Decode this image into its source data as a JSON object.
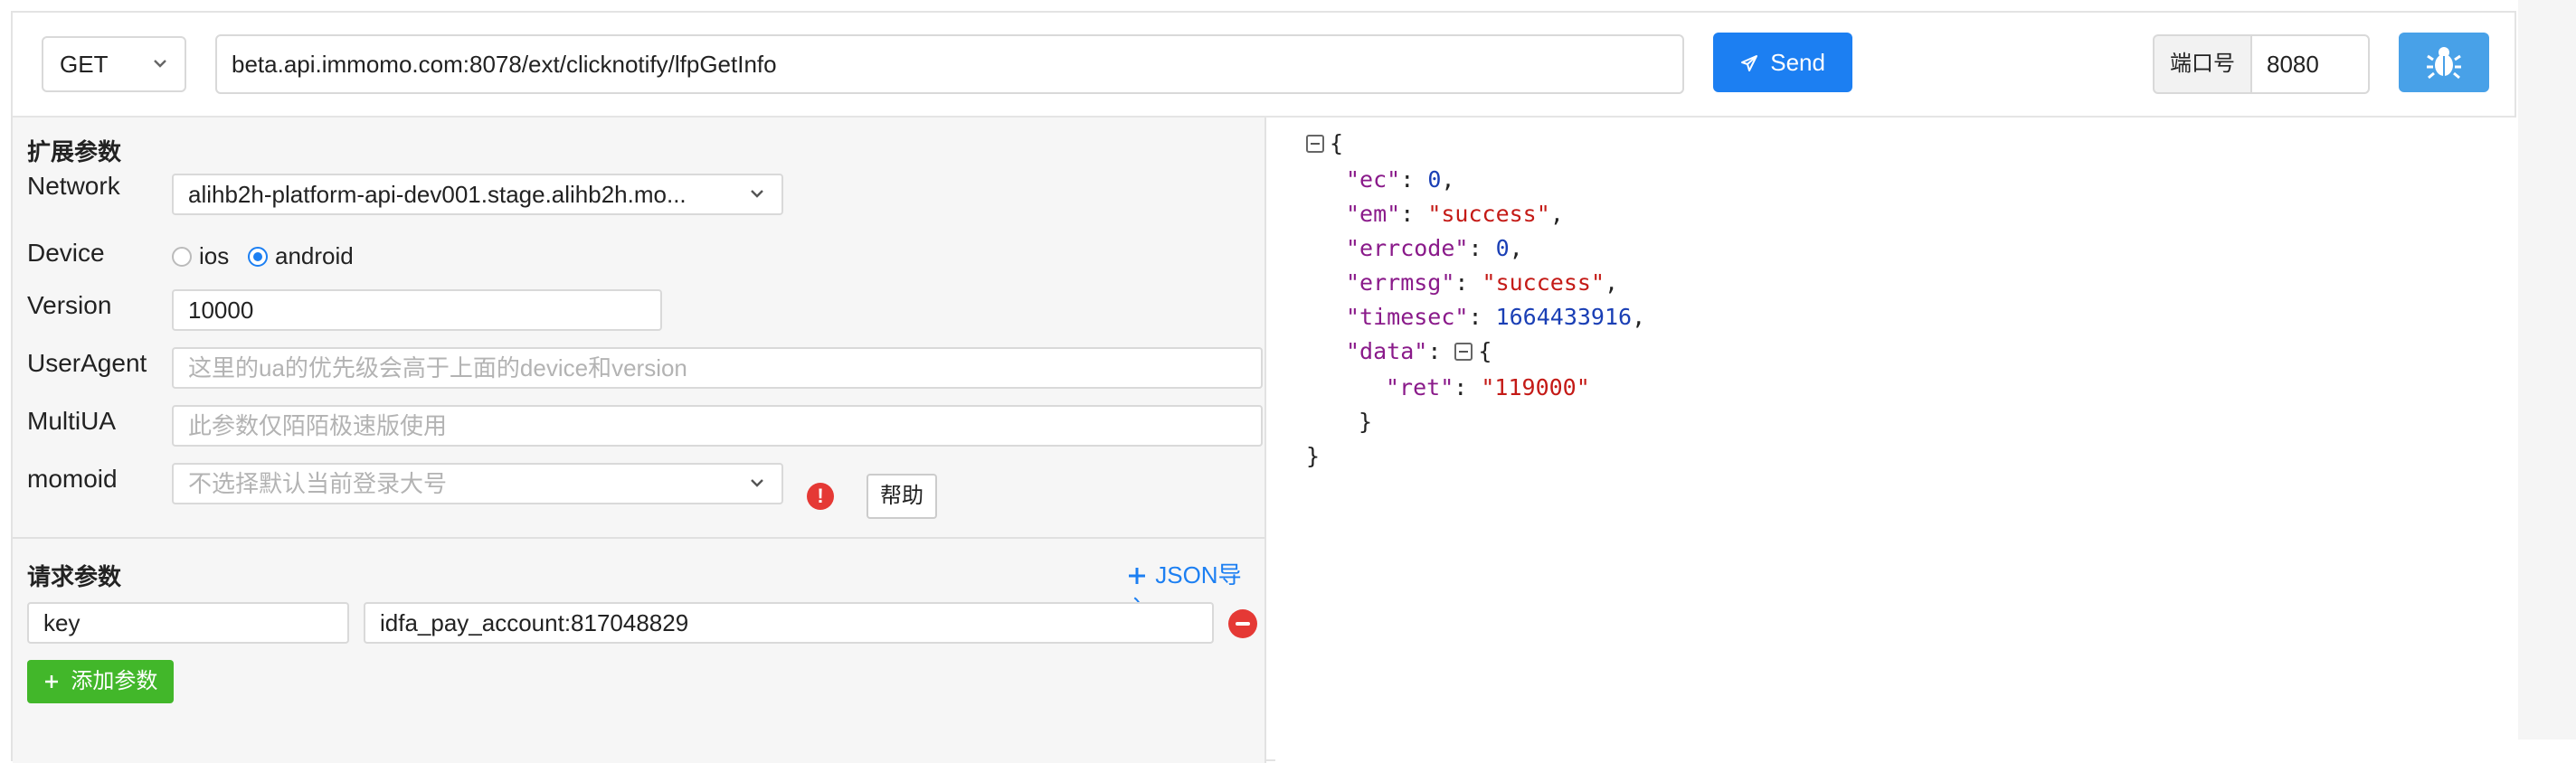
{
  "request": {
    "method": "GET",
    "url": "beta.api.immomo.com:8078/ext/clicknotify/lfpGetInfo",
    "send_label": "Send",
    "port_label": "端口号",
    "port_value": "8080"
  },
  "ext": {
    "title": "扩展参数",
    "network_label": "Network",
    "network_value": "alihb2h-platform-api-dev001.stage.alihb2h.mo...",
    "device_label": "Device",
    "device_options": [
      "ios",
      "android"
    ],
    "device_selected": "android",
    "version_label": "Version",
    "version_value": "10000",
    "ua_label": "UserAgent",
    "ua_placeholder": "这里的ua的优先级会高于上面的device和version",
    "multiua_label": "MultiUA",
    "multiua_placeholder": "此参数仅陌陌极速版使用",
    "momoid_label": "momoid",
    "momoid_placeholder": "不选择默认当前登录大号",
    "warning_glyph": "!",
    "help_label": "帮助"
  },
  "params": {
    "title": "请求参数",
    "json_import_label": "JSON导入",
    "rows": [
      {
        "key": "key",
        "value": "idfa_pay_account:817048829"
      }
    ],
    "add_label": "添加参数"
  },
  "response": {
    "ec": "0",
    "em": "\"success\"",
    "errcode": "0",
    "errmsg": "\"success\"",
    "timesec": "1664433916",
    "data_ret": "\"119000\""
  },
  "colors": {
    "primary": "#1c7ff2",
    "bug_button": "#48a1e8",
    "success": "#42b72a",
    "danger": "#e53935",
    "json_key": "#8a1a8a",
    "json_number": "#1a3fb5",
    "json_string": "#c41a16"
  },
  "icons": {
    "send": "paper-plane-icon",
    "debug": "bug-icon",
    "dropdown": "chevron-down-icon",
    "add": "plus-icon",
    "remove": "minus-circle-icon",
    "warning": "exclamation-circle-icon",
    "collapse": "collapse-square-icon"
  }
}
